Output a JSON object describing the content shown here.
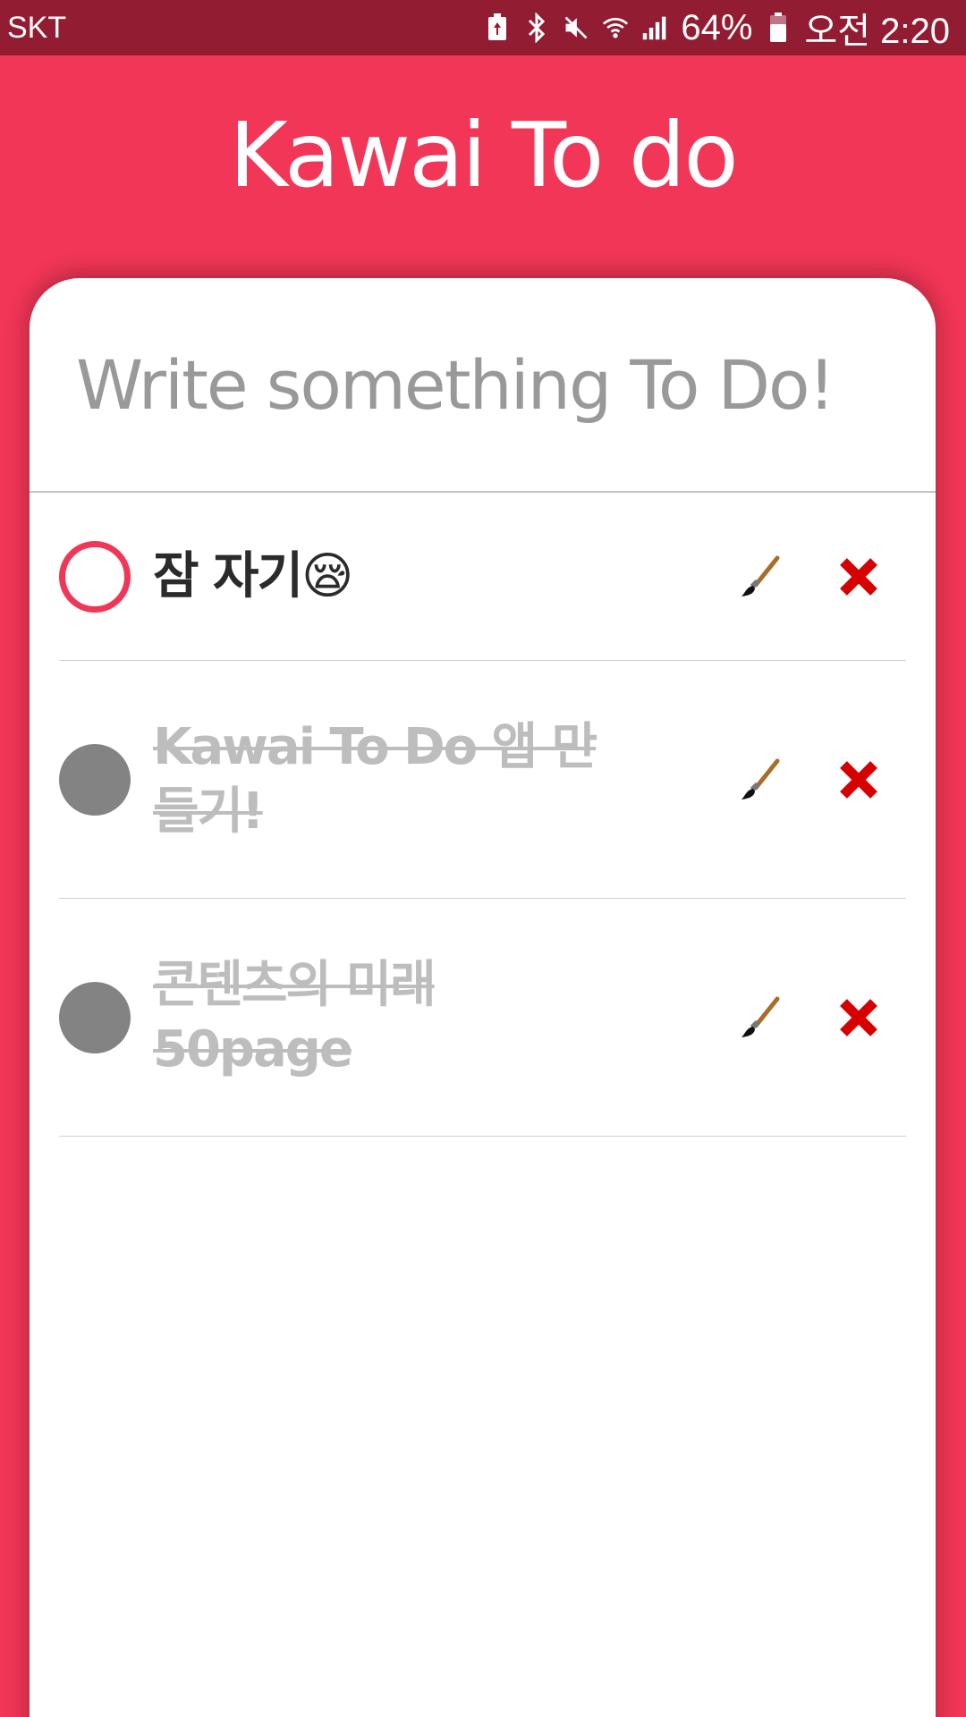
{
  "status_bar": {
    "carrier": "SKT",
    "battery_percent": "64%",
    "time": "오전 2:20"
  },
  "app": {
    "title": "Kawai To do"
  },
  "input": {
    "placeholder": "Write something To Do!"
  },
  "todos": [
    {
      "text": "잠 자기😪",
      "done": false
    },
    {
      "text": "Kawai To Do 앱 만들기!",
      "done": true
    },
    {
      "text": "콘텐츠의 미래 50page",
      "done": true
    }
  ],
  "icons": {
    "edit": "paintbrush-icon",
    "delete": "red-x-icon"
  },
  "colors": {
    "accent": "#f23657",
    "status_bar": "#921d33",
    "done_circle": "#838383",
    "done_text": "#bdbdbd"
  }
}
